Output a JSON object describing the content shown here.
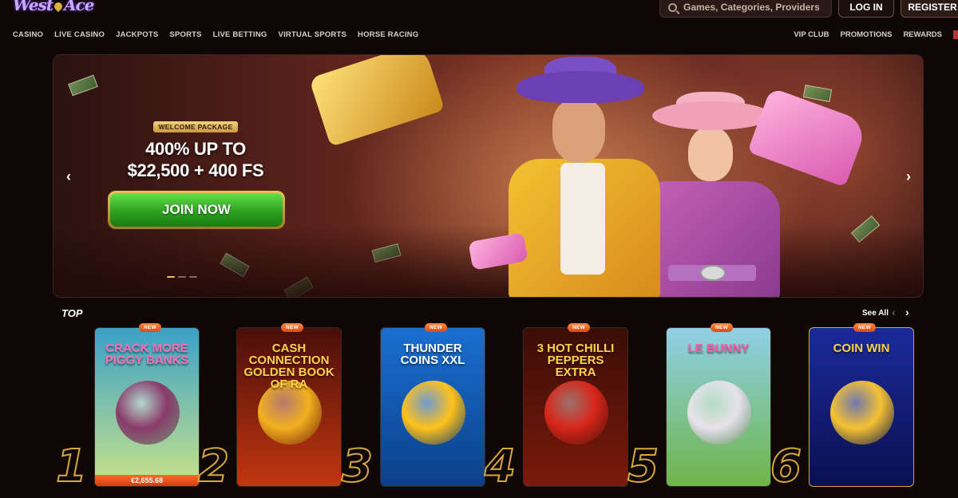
{
  "header": {
    "logo_text": "WestAce",
    "search_placeholder": "Games, Categories, Providers",
    "login_label": "LOG IN",
    "register_label": "REGISTER"
  },
  "nav_left": [
    "CASINO",
    "LIVE CASINO",
    "JACKPOTS",
    "SPORTS",
    "LIVE BETTING",
    "VIRTUAL SPORTS",
    "HORSE RACING"
  ],
  "nav_right": [
    "VIP CLUB",
    "PROMOTIONS",
    "REWARDS"
  ],
  "hero": {
    "badge": "WELCOME PACKAGE",
    "line1": "400% UP TO",
    "line2": "$22,500 + 400 FS",
    "cta": "JOIN NOW",
    "slides_total": 3,
    "active_slide": 1
  },
  "top_section": {
    "title": "TOP",
    "see_all": "See All"
  },
  "games": [
    {
      "rank": "1",
      "badge": "NEW",
      "title": "CRACK MORE PIGGY BANKS",
      "jackpot": "€2,655.68",
      "bg1": "#3aa1c9",
      "bg2": "#c9e38a",
      "title_color": "#ff6fb6",
      "emblem": "#8a3b6a"
    },
    {
      "rank": "2",
      "badge": "NEW",
      "title": "CASH CONNECTION GOLDEN BOOK OF RA",
      "jackpot": "",
      "bg1": "#4a0e0a",
      "bg2": "#c2360f",
      "title_color": "#ffd24a",
      "emblem": "#f2b01e"
    },
    {
      "rank": "3",
      "badge": "NEW",
      "title": "THUNDER COINS XXL",
      "jackpot": "",
      "bg1": "#1a6fd1",
      "bg2": "#0c3f8a",
      "title_color": "#ffffff",
      "emblem": "#ffc21a"
    },
    {
      "rank": "4",
      "badge": "NEW",
      "title": "3 HOT CHILLI PEPPERS EXTRA",
      "jackpot": "",
      "bg1": "#3a0d06",
      "bg2": "#7a1a0c",
      "title_color": "#ffd24a",
      "emblem": "#d8261a"
    },
    {
      "rank": "5",
      "badge": "NEW",
      "title": "LE BUNNY",
      "jackpot": "",
      "bg1": "#8fd0e8",
      "bg2": "#6fb548",
      "title_color": "#ff5aa8",
      "emblem": "#e7e2ea"
    },
    {
      "rank": "6",
      "badge": "NEW",
      "title": "COIN WIN",
      "jackpot": "",
      "bg1": "#1b2a9a",
      "bg2": "#0a1050",
      "title_color": "#ffd24a",
      "emblem": "#f5c232"
    }
  ]
}
